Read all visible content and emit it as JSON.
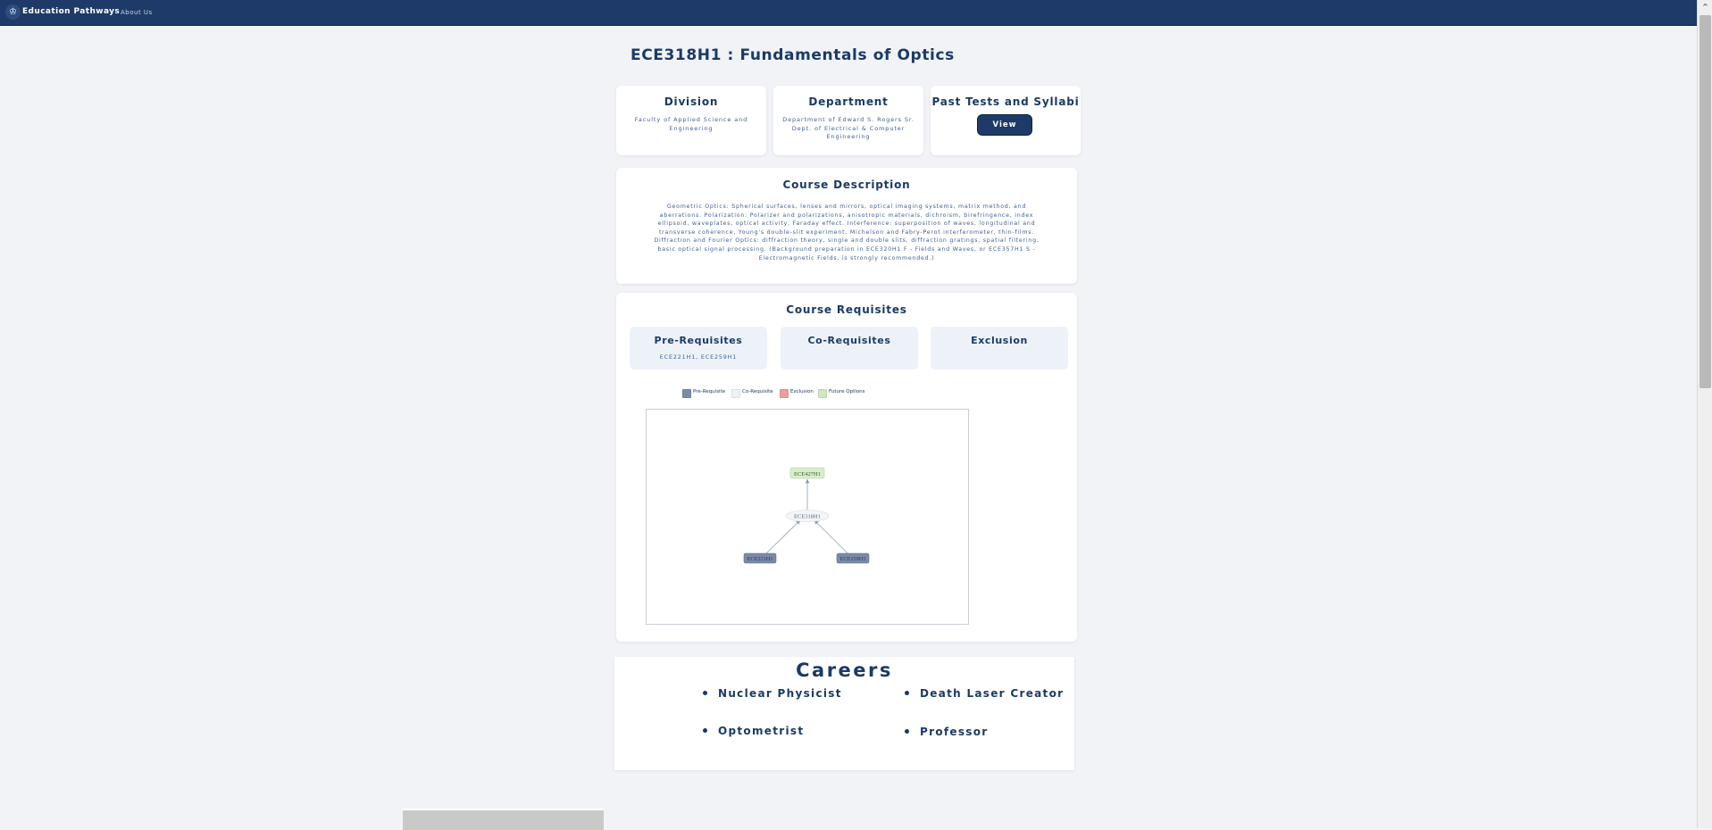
{
  "nav": {
    "brand": "Education Pathways",
    "about_link": "About Us"
  },
  "course": {
    "title": "ECE318H1 : Fundamentals of Optics"
  },
  "info_cards": {
    "division_heading": "Division",
    "division_value": "Faculty of Applied Science and Engineering",
    "department_heading": "Department",
    "department_value": "Department of Edward S. Rogers Sr. Dept. of Electrical & Computer Engineering",
    "tests_heading": "Past Tests and Syllabi",
    "view_button": "View"
  },
  "description": {
    "heading": "Course Description",
    "text": "Geometric Optics: Spherical surfaces, lenses and mirrors, optical imaging systems, matrix method, and aberrations. Polarization: Polarizer and polarizations, anisotropic materials, dichroism, birefringence, index ellipsoid, waveplates, optical activity, Faraday effect. Interference: superposition of waves, longitudinal and transverse coherence, Young's double-slit experiment, Michelson and Fabry-Perot interferometer, thin-films. Diffraction and Fourier Optics: diffraction theory, single and double slits, diffraction gratings, spatial filtering, basic optical signal processing. (Background preparation in ECE320H1 F - Fields and Waves, or ECE357H1 S - Electromagnetic Fields, is strongly recommended.)"
  },
  "requisites": {
    "heading": "Course Requisites",
    "prereq_heading": "Pre-Requisites",
    "prereq_value": "ECE221H1, ECE259H1",
    "coreq_heading": "Co-Requisites",
    "coreq_value": "",
    "exclusion_heading": "Exclusion",
    "exclusion_value": ""
  },
  "legend": [
    {
      "label": "Pre-Requisite",
      "color": "#7a8aa8"
    },
    {
      "label": "Co-Requisite",
      "color": "#eef1f6"
    },
    {
      "label": "Exclusion",
      "color": "#e9a0a0"
    },
    {
      "label": "Future Options",
      "color": "#cfe8c2"
    }
  ],
  "graph": {
    "nodes": {
      "future": "ECE427H1",
      "course": "ECE318H1",
      "prereq_a": "ECE221H1",
      "prereq_b": "ECE259H1"
    },
    "colors": {
      "future_fill": "#d8edcd",
      "course_fill": "#f3f5f9",
      "prereq_fill": "#7a8aa8",
      "edge": "#8f9cb3"
    }
  },
  "careers": {
    "heading": "Careers",
    "items": [
      "Nuclear Physicist",
      "Death Laser Creator",
      "Optometrist",
      "Professor"
    ]
  },
  "colors": {
    "navy": "#1e3a68",
    "page_bg": "#f1f3f7",
    "card_bg": "#ffffff",
    "requisite_box_bg": "#edf2f9"
  },
  "icons": {
    "logo": "university-crest-icon",
    "scroll_up": "chevron-up-icon"
  }
}
